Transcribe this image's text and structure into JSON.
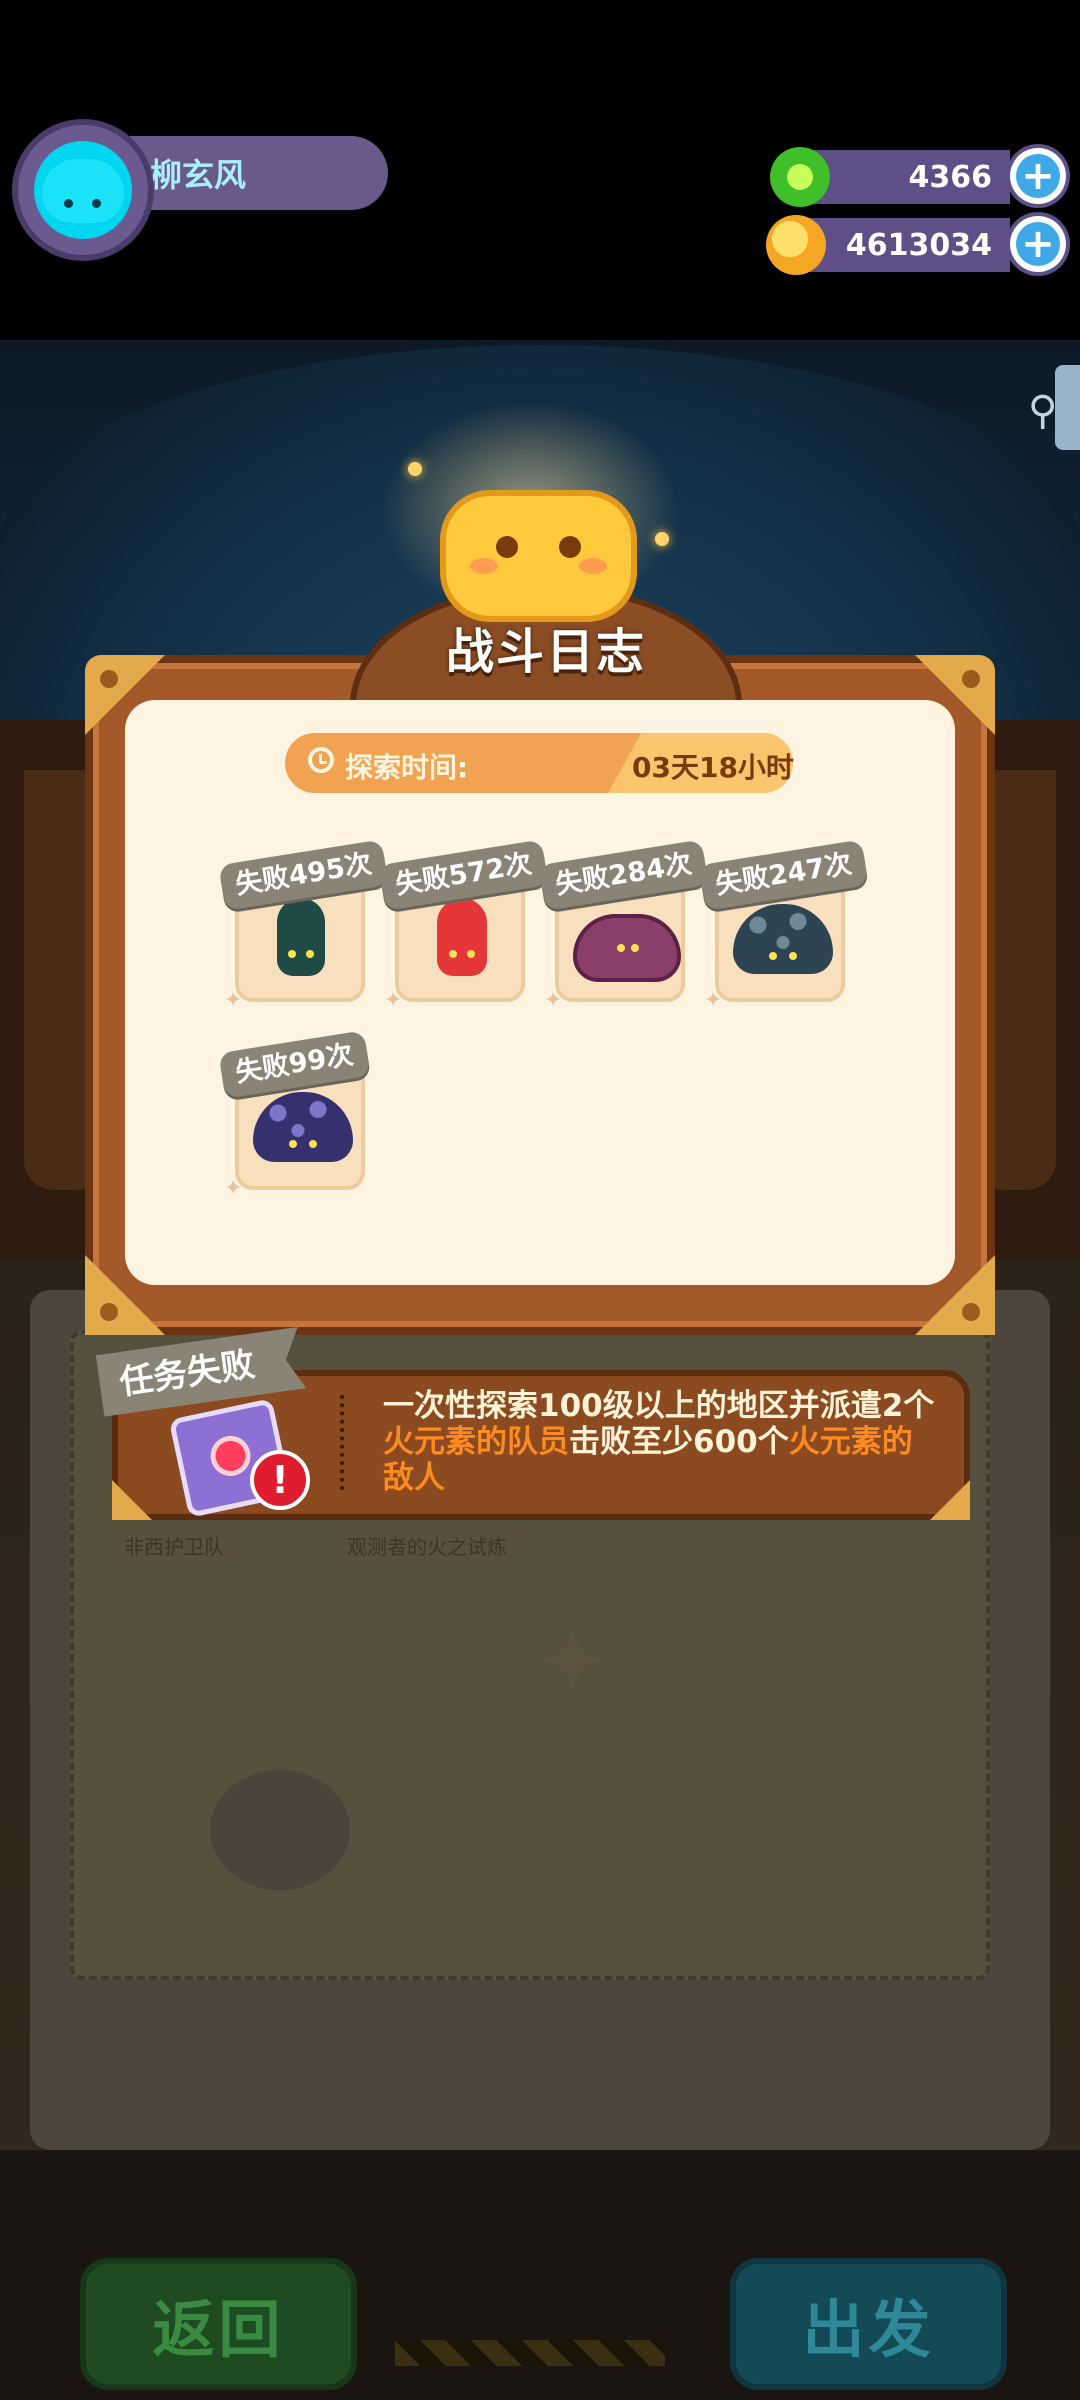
{
  "player": {
    "name": "柳玄风"
  },
  "currency": [
    {
      "icon": "green-gem-icon",
      "value": "4366",
      "color": "#3fbf2a"
    },
    {
      "icon": "gold-planet-icon",
      "value": "4613034",
      "color": "#f5a623"
    }
  ],
  "dialog": {
    "title": "战斗日志",
    "time_label": "探索时间:",
    "time_value": "03天18小时",
    "enemies": [
      {
        "fail_text": "失败495次",
        "type": "dark-green-ghost"
      },
      {
        "fail_text": "失败572次",
        "type": "red-ghost"
      },
      {
        "fail_text": "失败284次",
        "type": "purple-clam"
      },
      {
        "fail_text": "失败247次",
        "type": "blue-spotted-mushroom"
      },
      {
        "fail_text": "失败99次",
        "type": "indigo-spotted-mushroom"
      }
    ]
  },
  "mission": {
    "status_label": "任务失败",
    "text_parts": [
      {
        "text": "一次性探索100级以上的地区并派遣2个",
        "highlight": false
      },
      {
        "text": "火元素的队员",
        "highlight": true
      },
      {
        "text": "击败至少600个",
        "highlight": false
      },
      {
        "text": "火元素的敌人",
        "highlight": true
      }
    ]
  },
  "background": {
    "labels": [
      "非西护卫队",
      "观测者的火之试炼"
    ]
  },
  "buttons": {
    "back": "返回",
    "go": "出发"
  },
  "colors": {
    "accent_orange": "#ff8a1f",
    "frame_brown": "#a35a28",
    "panel_cream": "#fff3e2"
  }
}
